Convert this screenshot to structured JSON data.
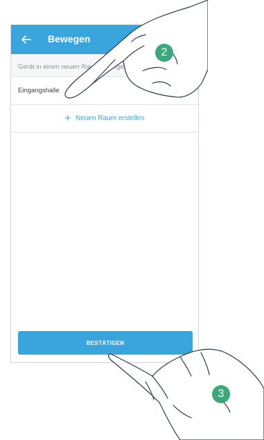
{
  "header": {
    "title": "Bewegen"
  },
  "subtitle": "Gerät in einen neuen Raum bewegen",
  "rooms": [
    {
      "label": "Eingangshalle",
      "selected": true
    }
  ],
  "new_room": {
    "label": "Neuen Raum erstellen"
  },
  "confirm_button": {
    "label": "BESTÄTIGEN"
  },
  "steps": {
    "step_a": "2",
    "step_b": "3"
  },
  "colors": {
    "accent": "#3aa5dc",
    "step_badge": "#3da67b"
  },
  "icons": {
    "back": "arrow-left-icon",
    "add": "plus-icon",
    "selected": "checkmark-icon"
  }
}
